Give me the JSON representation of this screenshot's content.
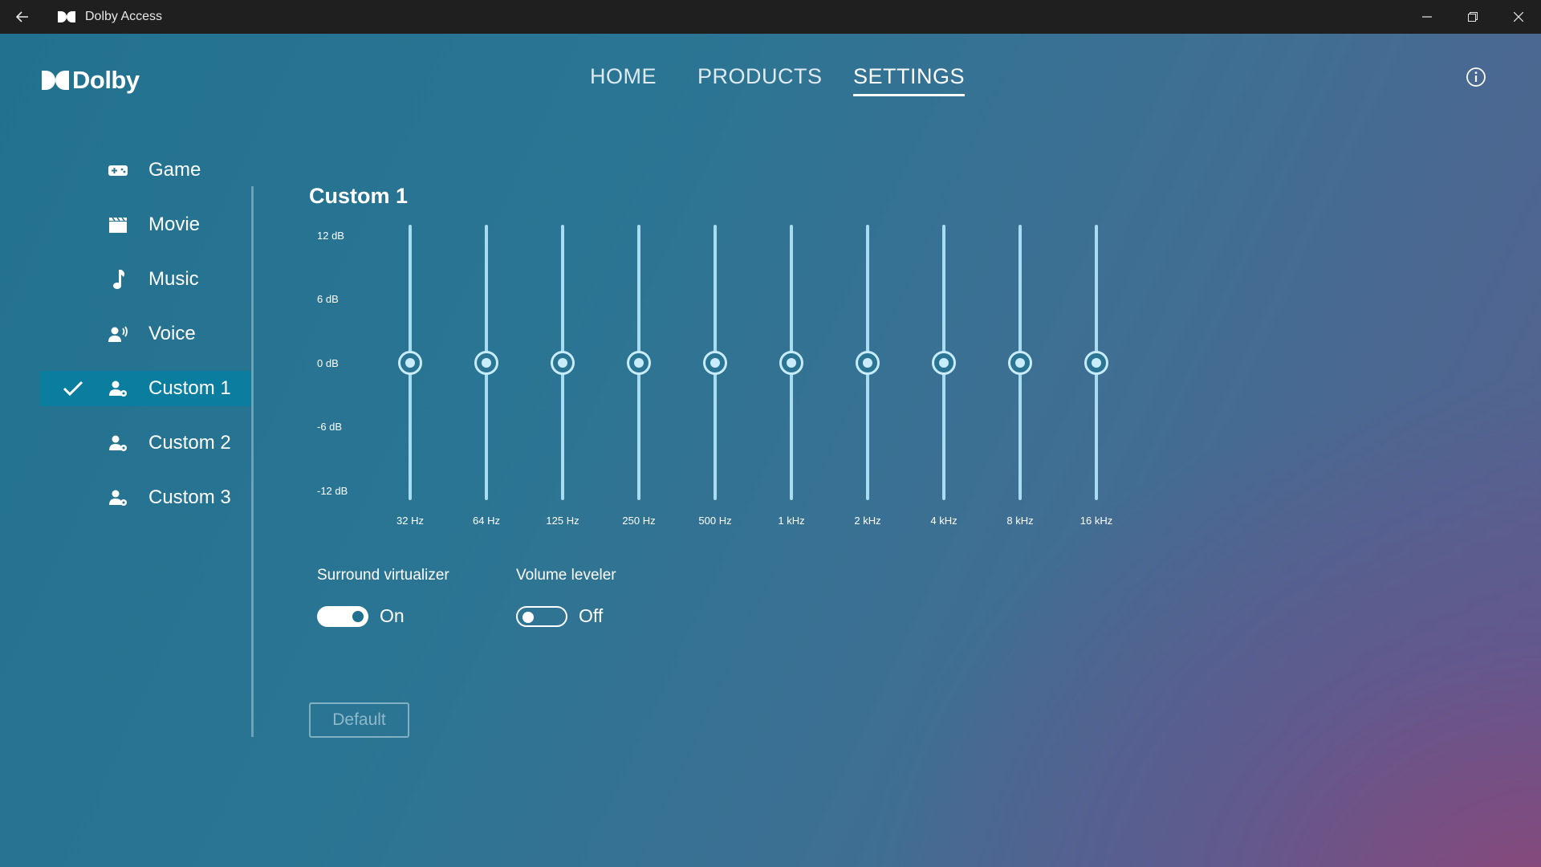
{
  "titlebar": {
    "title": "Dolby Access",
    "icons": {
      "back": "back-arrow-icon",
      "logo": "dolby-logo-icon",
      "minimize": "minimize-icon",
      "restore": "restore-icon",
      "close": "close-icon"
    }
  },
  "brand": {
    "wordmark": "Dolby"
  },
  "nav": {
    "items": [
      {
        "label": "HOME"
      },
      {
        "label": "PRODUCTS"
      },
      {
        "label": "SETTINGS"
      }
    ],
    "active": "SETTINGS",
    "info_icon": "info-icon"
  },
  "sidebar": {
    "items": [
      {
        "label": "Game",
        "icon": "gamepad-icon"
      },
      {
        "label": "Movie",
        "icon": "clapperboard-icon"
      },
      {
        "label": "Music",
        "icon": "music-note-icon"
      },
      {
        "label": "Voice",
        "icon": "voice-icon"
      },
      {
        "label": "Custom 1",
        "icon": "custom-profile-icon"
      },
      {
        "label": "Custom 2",
        "icon": "custom-profile-icon"
      },
      {
        "label": "Custom 3",
        "icon": "custom-profile-icon"
      }
    ],
    "selected": "Custom 1"
  },
  "equalizer": {
    "title": "Custom 1",
    "db_labels": [
      "12 dB",
      "6 dB",
      "0 dB",
      "-6 dB",
      "-12 dB"
    ],
    "range_db": [
      -12,
      12
    ],
    "bands": [
      {
        "freq": "32 Hz",
        "gain_db": 0
      },
      {
        "freq": "64 Hz",
        "gain_db": 0
      },
      {
        "freq": "125 Hz",
        "gain_db": 0
      },
      {
        "freq": "250 Hz",
        "gain_db": 0
      },
      {
        "freq": "500 Hz",
        "gain_db": 0
      },
      {
        "freq": "1 kHz",
        "gain_db": 0
      },
      {
        "freq": "2 kHz",
        "gain_db": 0
      },
      {
        "freq": "4 kHz",
        "gain_db": 0
      },
      {
        "freq": "8 kHz",
        "gain_db": 0
      },
      {
        "freq": "16 kHz",
        "gain_db": 0
      }
    ]
  },
  "toggles": {
    "surround": {
      "label": "Surround virtualizer",
      "state": "On",
      "on": true
    },
    "leveler": {
      "label": "Volume leveler",
      "state": "Off",
      "on": false
    }
  },
  "default_button": {
    "label": "Default"
  }
}
